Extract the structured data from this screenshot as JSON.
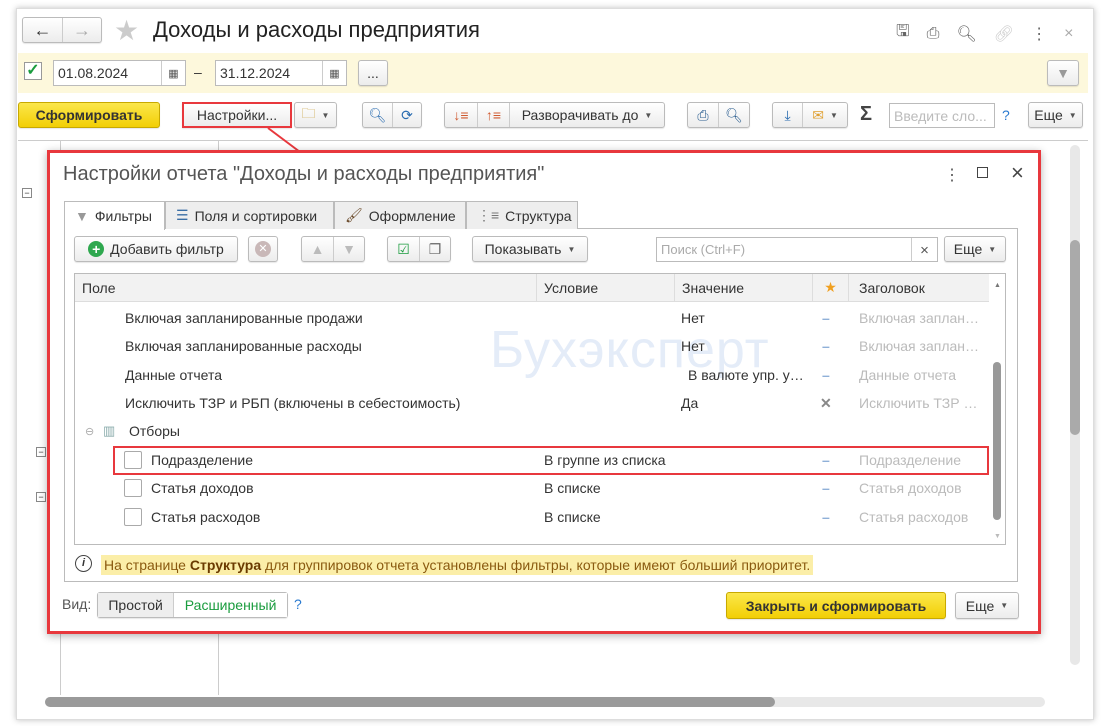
{
  "window": {
    "title": "Доходы и расходы предприятия",
    "icons": [
      "save-icon",
      "print-icon",
      "preview-icon",
      "link-icon",
      "more-icon",
      "close-icon"
    ]
  },
  "period": {
    "enabled": true,
    "from": "01.08.2024",
    "separator": "–",
    "to": "31.12.2024",
    "more_label": "..."
  },
  "toolbar": {
    "generate": "Сформировать",
    "settings": "Настройки...",
    "expand_to": "Разворачивать до",
    "sigma": "Σ",
    "search_placeholder": "Введите сло...",
    "help": "?",
    "more": "Еще"
  },
  "dialog": {
    "title": "Настройки отчета \"Доходы и расходы предприятия\"",
    "tabs": [
      {
        "label": "Фильтры",
        "active": true
      },
      {
        "label": "Поля и сортировки"
      },
      {
        "label": "Оформление"
      },
      {
        "label": "Структура"
      }
    ],
    "add_filter": "Добавить фильтр",
    "show": "Показывать",
    "search_placeholder": "Поиск (Ctrl+F)",
    "more": "Еще",
    "columns": {
      "field": "Поле",
      "condition": "Условие",
      "value": "Значение",
      "title": "Заголовок"
    },
    "rows": [
      {
        "field": "Включая запланированные продажи",
        "condition": "",
        "value": "Нет",
        "mark": "–",
        "title": "Включая заплан…"
      },
      {
        "field": "Включая запланированные расходы",
        "condition": "",
        "value": "Нет",
        "mark": "–",
        "title": "Включая заплан…"
      },
      {
        "field": "Данные отчета",
        "condition": "",
        "value": "В валюте упр. у…",
        "mark": "–",
        "title": "Данные отчета"
      },
      {
        "field": "Исключить ТЗР и РБП (включены в себестоимость)",
        "condition": "",
        "value": "Да",
        "mark": "✕",
        "title": "Исключить ТЗР …"
      }
    ],
    "group": {
      "label": "Отборы"
    },
    "filters": [
      {
        "field": "Подразделение",
        "condition": "В группе из списка",
        "mark": "–",
        "title": "Подразделение",
        "checked": false,
        "highlighted": true
      },
      {
        "field": "Статья доходов",
        "condition": "В списке",
        "mark": "–",
        "title": "Статья доходов",
        "checked": false
      },
      {
        "field": "Статья расходов",
        "condition": "В списке",
        "mark": "–",
        "title": "Статья расходов",
        "checked": false
      }
    ],
    "info": {
      "before": "На странице ",
      "bold": "Структура",
      "after": " для группировок отчета установлены фильтры, которые имеют больший приоритет."
    },
    "view_label": "Вид:",
    "view_simple": "Простой",
    "view_extended": "Расширенный",
    "help": "?",
    "close_generate": "Закрыть и сформировать"
  },
  "watermark": "Бухэксперт",
  "colors": {
    "accent_red": "#e8383d",
    "yellow": "#f5d80f",
    "notice_bg": "#fbeea8",
    "green": "#1a9c3e"
  }
}
